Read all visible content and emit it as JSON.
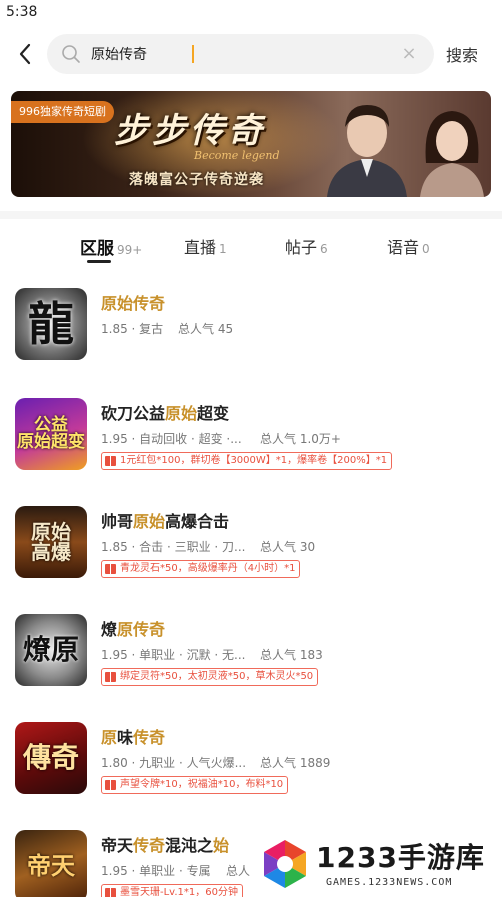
{
  "status_bar": {
    "time": "5:38"
  },
  "search": {
    "query": "原始传奇",
    "submit_label": "搜索"
  },
  "banner": {
    "tag": "996独家传奇短剧",
    "title": "步步传奇",
    "english": "Become legend",
    "subtitle": "落魄富公子传奇逆袭"
  },
  "tabs": [
    {
      "label": "区服",
      "count": "99+"
    },
    {
      "label": "直播",
      "count": "1"
    },
    {
      "label": "帖子",
      "count": "6"
    },
    {
      "label": "语音",
      "count": "0"
    }
  ],
  "results": [
    {
      "name_pre": "",
      "name_hl": "原始传奇",
      "name_post": "",
      "name_hl2": "",
      "name_post2": "",
      "meta": "1.85 · 复古",
      "popularity": "总人气 45",
      "gift": "",
      "thumb_text": "龍"
    },
    {
      "name_pre": "砍刀公益",
      "name_hl": "原始",
      "name_post": "超变",
      "name_hl2": "",
      "name_post2": "",
      "meta": "1.95 · 自动回收 · 超变 ·...",
      "popularity": "总人气 1.0万+",
      "gift": "1元红包*100，群切卷【3000W】*1，爆率卷【200%】*1",
      "thumb_text": "公益\n原始超变"
    },
    {
      "name_pre": "帅哥",
      "name_hl": "原始",
      "name_post": "高爆合击",
      "name_hl2": "",
      "name_post2": "",
      "meta": "1.85 · 合击 · 三职业 · 刀...",
      "popularity": "总人气 30",
      "gift": "青龙灵石*50，高级爆率丹（4小时）*1",
      "thumb_text": "原始\n高爆"
    },
    {
      "name_pre": "燎",
      "name_hl": "原传奇",
      "name_post": "",
      "name_hl2": "",
      "name_post2": "",
      "meta": "1.95 · 单职业 · 沉默 · 无...",
      "popularity": "总人气 183",
      "gift": "绑定灵符*50，太初灵液*50，草木灵火*50",
      "thumb_text": "燎原"
    },
    {
      "name_pre": "",
      "name_hl": "原",
      "name_post": "味",
      "name_hl2": "传奇",
      "name_post2": "",
      "meta": "1.80 · 九职业 · 人气火爆...",
      "popularity": "总人气 1889",
      "gift": "声望令牌*10，祝福油*10，布料*10",
      "thumb_text": "傳奇"
    },
    {
      "name_pre": "帝天",
      "name_hl": "传奇",
      "name_post": "混沌之",
      "name_hl2": "始",
      "name_post2": "",
      "meta": "1.95 · 单职业 · 专属",
      "popularity": "总人",
      "gift": "墨雪天珊-Lv.1*1，60分钟",
      "thumb_text": "帝天"
    }
  ],
  "watermark": {
    "brand": "1233手游库",
    "url": "GAMES.1233NEWS.COM"
  },
  "colors": {
    "highlight": "#c8912b",
    "gift_red": "#e8503e",
    "accent_caret": "#f5a623"
  }
}
